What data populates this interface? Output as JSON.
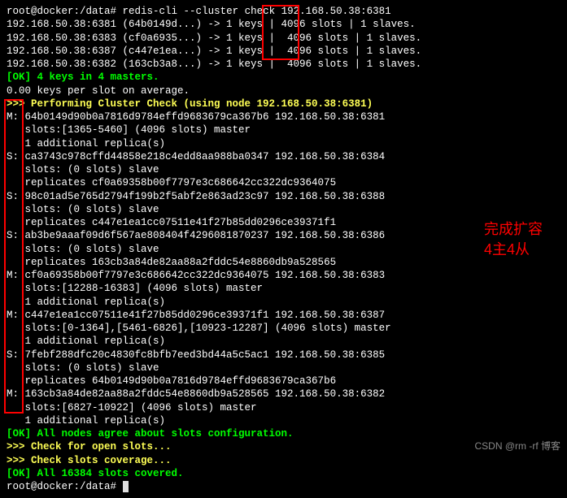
{
  "prompt": {
    "user_host": "root@docker",
    "path": ":/data#",
    "cmd": "redis-cli --cluster check 192.168.50.38:6381"
  },
  "top": [
    {
      "addr": "192.168.50.38:6381",
      "id": "(64b0149d...)",
      "arrow": "-> 1 keys |",
      "slots": "4096",
      "rest": "slots | 1 slaves."
    },
    {
      "addr": "192.168.50.38:6383",
      "id": "(cf0a6935...)",
      "arrow": "-> 1 keys |",
      "slots": " 4096",
      "rest": "slots | 1 slaves."
    },
    {
      "addr": "192.168.50.38:6387",
      "id": "(c447e1ea...)",
      "arrow": "-> 1 keys |",
      "slots": " 4096",
      "rest": "slots | 1 slaves."
    },
    {
      "addr": "192.168.50.38:6382",
      "id": "(163cb3a8...)",
      "arrow": "-> 1 keys |",
      "slots": " 4096",
      "rest": "slots | 1 slaves."
    }
  ],
  "ok_keys": "[OK] 4 keys in 4 masters.",
  "avg": "0.00 keys per slot on average.",
  "perf": ">>> Performing Cluster Check (using node 192.168.50.38:6381)",
  "entries": [
    {
      "tag": "M:",
      "l1": "64b0149d90b0a7816d9784effd9683679ca367b6 192.168.50.38:6381",
      "l2": "slots:[1365-5460] (4096 slots) master",
      "l3": "1 additional replica(s)"
    },
    {
      "tag": "S:",
      "l1": "ca3743c978cffd44858e218c4edd8aa988ba0347 192.168.50.38:6384",
      "l2": "slots: (0 slots) slave",
      "l3": "replicates cf0a69358b00f7797e3c686642cc322dc9364075"
    },
    {
      "tag": "S:",
      "l1": "98c01ad5e765d2794f199b2f5abf2e863ad23c97 192.168.50.38:6388",
      "l2": "slots: (0 slots) slave",
      "l3": "replicates c447e1ea1cc07511e41f27b85dd0296ce39371f1"
    },
    {
      "tag": "S:",
      "l1": "ab3be9aaaf09d6f567ae808404f4296081870237 192.168.50.38:6386",
      "l2": "slots: (0 slots) slave",
      "l3": "replicates 163cb3a84de82aa88a2fddc54e8860db9a528565"
    },
    {
      "tag": "M:",
      "l1": "cf0a69358b00f7797e3c686642cc322dc9364075 192.168.50.38:6383",
      "l2": "slots:[12288-16383] (4096 slots) master",
      "l3": "1 additional replica(s)"
    },
    {
      "tag": "M:",
      "l1": "c447e1ea1cc07511e41f27b85dd0296ce39371f1 192.168.50.38:6387",
      "l2": "slots:[0-1364],[5461-6826],[10923-12287] (4096 slots) master",
      "l3": "1 additional replica(s)"
    },
    {
      "tag": "S:",
      "l1": "7febf288dfc20c4830fc8bfb7eed3bd44a5c5ac1 192.168.50.38:6385",
      "l2": "slots: (0 slots) slave",
      "l3": "replicates 64b0149d90b0a7816d9784effd9683679ca367b6"
    },
    {
      "tag": "M:",
      "l1": "163cb3a84de82aa88a2fddc54e8860db9a528565 192.168.50.38:6382",
      "l2": "slots:[6827-10922] (4096 slots) master",
      "l3": "1 additional replica(s)"
    }
  ],
  "ok_agree": "[OK] All nodes agree about slots configuration.",
  "check_open": ">>> Check for open slots...",
  "check_cov": ">>> Check slots coverage...",
  "ok_cov": "[OK] All 16384 slots covered.",
  "prompt2": "root@docker:/data#",
  "annotation": {
    "l1": "完成扩容",
    "l2": "4主4从"
  },
  "watermark": "CSDN @rm -rf 博客"
}
